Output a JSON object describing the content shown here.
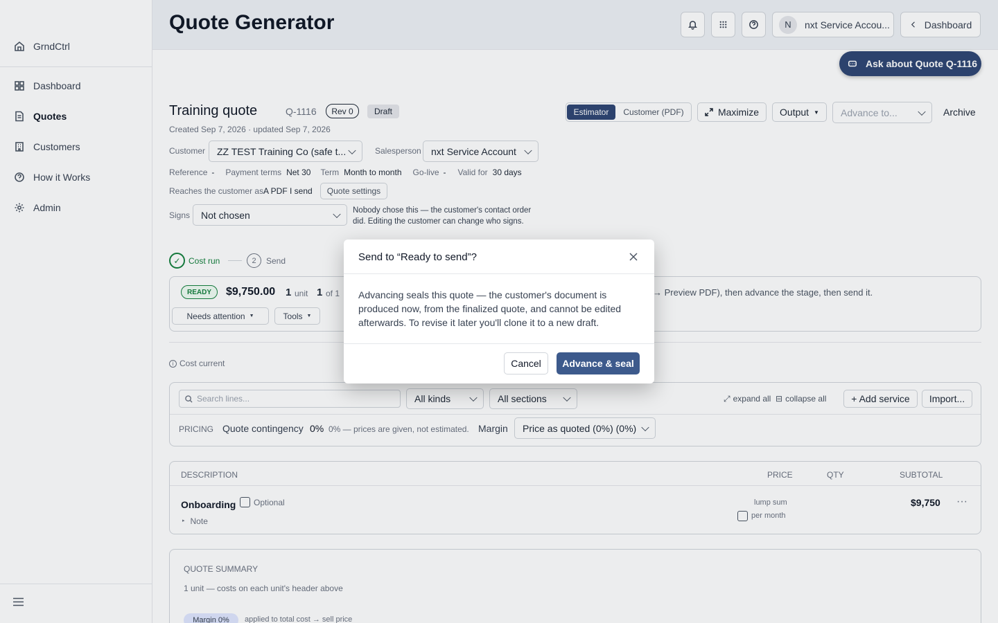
{
  "sidebar": {
    "brand": "GrndCtrl",
    "items": [
      {
        "label": "Dashboard",
        "icon": "dashboard-icon"
      },
      {
        "label": "Quotes",
        "icon": "document-icon"
      },
      {
        "label": "Customers",
        "icon": "building-icon"
      },
      {
        "label": "How it Works",
        "icon": "help-circle-icon"
      },
      {
        "label": "Admin",
        "icon": "gear-icon"
      }
    ]
  },
  "header": {
    "title": "Quote Generator",
    "avatar_letter": "N",
    "account": "nxt Service Accou...",
    "dashboard": "Dashboard",
    "ask": "Ask about Quote Q-1116"
  },
  "quote": {
    "name": "Training quote",
    "id": "Q-1116",
    "rev": "Rev 0",
    "status": "Draft",
    "meta": "Created Sep 7, 2026 · updated Sep 7, 2026",
    "view_tabs": [
      "Estimator",
      "Customer (PDF)"
    ],
    "maximize": "Maximize",
    "output": "Output",
    "advance_placeholder": "Advance to...",
    "archive": "Archive",
    "customer_label": "Customer",
    "customer": "ZZ TEST Training Co (safe t...",
    "salesperson_label": "Salesperson",
    "salesperson": "nxt Service Account",
    "reference_label": "Reference",
    "reference": "-",
    "payment_label": "Payment terms",
    "payment": "Net 30",
    "term_label": "Term",
    "term": "Month to month",
    "golive_label": "Go-live",
    "golive": "-",
    "valid_label": "Valid for",
    "valid": "30 days",
    "reaches_label": "Reaches the customer as",
    "reaches": "A PDF I send",
    "quote_settings": "Quote settings",
    "signs_label": "Signs",
    "signs": "Not chosen",
    "signs_note_1": "Nobody chose this — the customer's contact order",
    "signs_note_2": "did. Editing the customer can change who signs."
  },
  "steps": {
    "step1": "Cost run",
    "step2_num": "2",
    "step2": "Send"
  },
  "status_card": {
    "badge": "READY",
    "amount": "$9,750.00",
    "units": "1",
    "units_label": "unit",
    "of": "1",
    "of_label": "of 1",
    "hint": "→ Preview PDF), then advance the stage, then send it.",
    "needs_attention": "Needs attention",
    "tools": "Tools"
  },
  "cost_current": "Cost current",
  "filters": {
    "search_placeholder": "Search lines...",
    "kinds": "All kinds",
    "sections": "All sections",
    "expand_all": "expand all",
    "collapse_all": "collapse all",
    "add_service": "+ Add service",
    "import": "Import..."
  },
  "pricing": {
    "label": "PRICING",
    "contingency_label": "Quote contingency",
    "contingency": "0%",
    "contingency_note": "0% — prices are given, not estimated.",
    "margin_label": "Margin",
    "margin": "Price as quoted (0%) (0%)"
  },
  "table": {
    "headers": {
      "description": "DESCRIPTION",
      "price": "PRICE",
      "qty": "QTY",
      "subtotal": "SUBTOTAL"
    },
    "row": {
      "name": "Onboarding",
      "optional": "Optional",
      "note": "Note",
      "price_type": "lump sum",
      "per_month": "per month",
      "subtotal": "$9,750"
    }
  },
  "summary": {
    "title": "QUOTE SUMMARY",
    "units_note": "1 unit — costs on each unit's header above",
    "margin_badge": "Margin 0%",
    "margin_note": "applied to total cost → sell price"
  },
  "modal": {
    "title": "Send to “Ready to send”?",
    "body": "Advancing seals this quote — the customer's document is produced now, from the finalized quote, and cannot be edited afterwards. To revise it later you'll clone it to a new draft.",
    "cancel": "Cancel",
    "confirm": "Advance & seal"
  }
}
